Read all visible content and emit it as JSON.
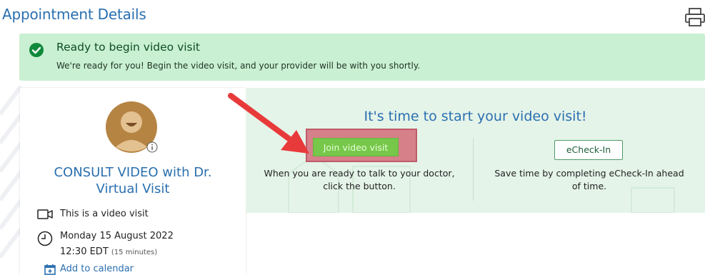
{
  "header": {
    "title": "Appointment Details",
    "print_icon": "printer-icon"
  },
  "banner": {
    "icon": "check-circle-icon",
    "title": "Ready to begin video visit",
    "message": "We're ready for you! Begin the video visit, and your provider will be with you shortly."
  },
  "appointment": {
    "avatar_icon": "provider-avatar",
    "info_icon": "info-icon",
    "title_line1": "CONSULT VIDEO with Dr.",
    "title_line2": "Virtual Visit",
    "video_label": "This is a video visit",
    "date": "Monday 15 August 2022",
    "time": "12:30 EDT",
    "duration": "(15 minutes)",
    "add_to_calendar": "Add to calendar"
  },
  "video_panel": {
    "heading": "It's time to start your video visit!",
    "join_button": "Join video visit",
    "join_text_line1": "When you are ready to talk to your doctor,",
    "join_text_line2": "click the button.",
    "echeck_button": "eCheck-In",
    "echeck_text_line1": "Save time by completing eCheck-In ahead",
    "echeck_text_line2": "of time."
  },
  "colors": {
    "title_blue": "#2a6fb0",
    "banner_green": "#c9f0d2",
    "panel_green": "#e5f4e9",
    "join_green": "#76c74a",
    "annotation_red": "#e83a3a"
  }
}
